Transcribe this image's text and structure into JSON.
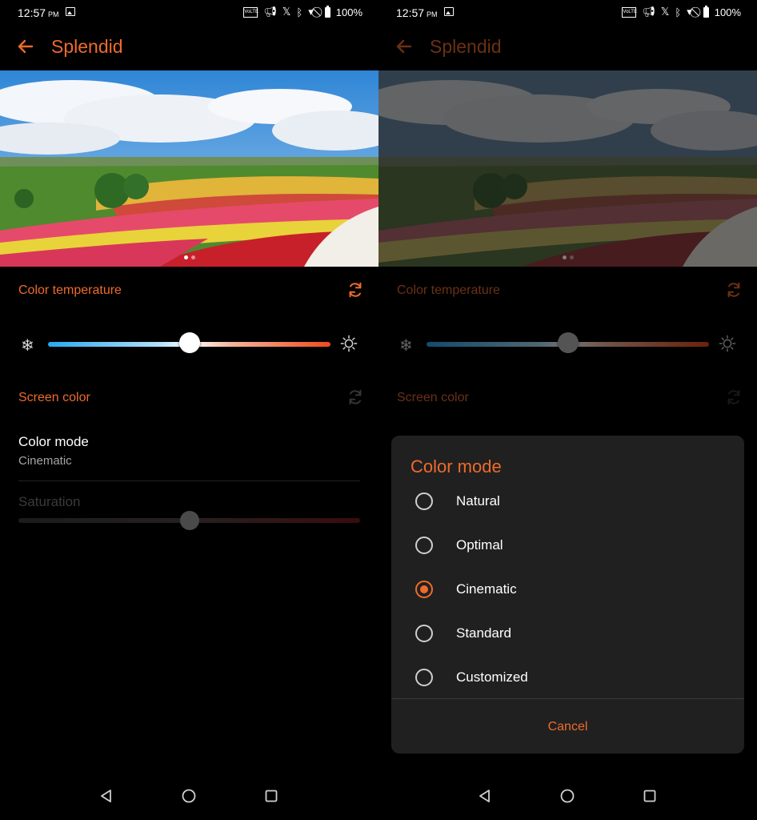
{
  "colors": {
    "accent": "#ee6b2b",
    "background": "#000000",
    "dialog_bg": "#202020"
  },
  "status_bar": {
    "time": "12:57",
    "ampm": "PM",
    "network_badge": "VoLTE",
    "battery": "100%"
  },
  "app_bar": {
    "title": "Splendid",
    "back_icon": "arrow-left-icon"
  },
  "preview": {
    "page_count": 2,
    "active_page": 1
  },
  "color_temperature": {
    "title": "Color temperature",
    "value_percent": 50,
    "cool_icon": "snowflake-icon",
    "warm_icon": "sun-icon",
    "reset_icon": "refresh-icon"
  },
  "screen_color": {
    "title": "Screen color",
    "reset_icon": "refresh-icon"
  },
  "color_mode": {
    "title": "Color mode",
    "value": "Cinematic"
  },
  "saturation": {
    "label": "Saturation",
    "value_percent": 50,
    "enabled": false
  },
  "dialog": {
    "title": "Color mode",
    "options": [
      {
        "label": "Natural",
        "selected": false
      },
      {
        "label": "Optimal",
        "selected": false
      },
      {
        "label": "Cinematic",
        "selected": true
      },
      {
        "label": "Standard",
        "selected": false
      },
      {
        "label": "Customized",
        "selected": false
      }
    ],
    "cancel_label": "Cancel"
  },
  "nav_bar": {
    "back": "back-triangle-icon",
    "home": "home-circle-icon",
    "recents": "recents-square-icon"
  }
}
